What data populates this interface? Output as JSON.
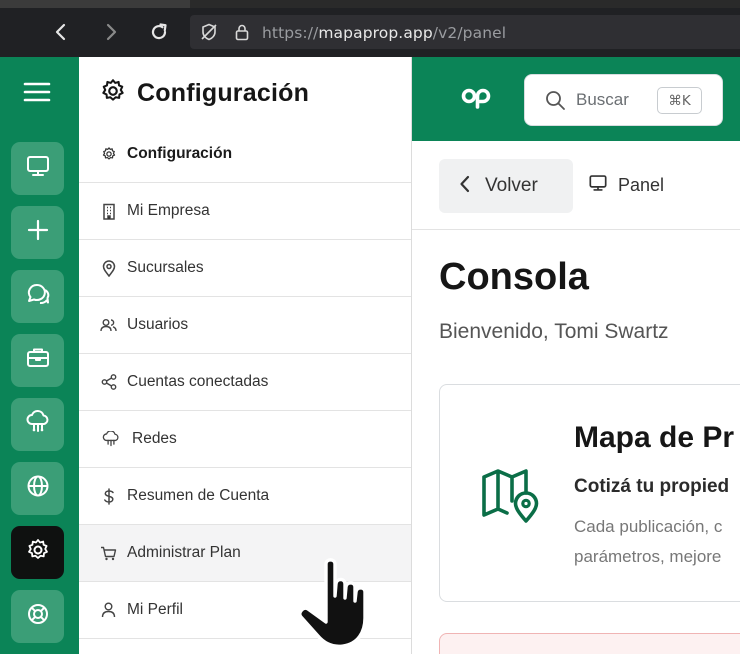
{
  "browser": {
    "url_prefix": "https://",
    "url_host": "mapaprop.app",
    "url_path": "/v2/panel",
    "icons": [
      "back-icon",
      "forward-icon",
      "reload-icon",
      "shield-off-icon",
      "lock-icon"
    ]
  },
  "rail": {
    "items": [
      {
        "name": "menu",
        "icon": "hamburger-icon"
      },
      {
        "name": "panel",
        "icon": "monitor-icon"
      },
      {
        "name": "nuevo",
        "icon": "plus-icon"
      },
      {
        "name": "mensajes",
        "icon": "chat-icon"
      },
      {
        "name": "negocios",
        "icon": "briefcase-icon"
      },
      {
        "name": "redes",
        "icon": "cloud-network-icon"
      },
      {
        "name": "web",
        "icon": "globe-icon"
      },
      {
        "name": "configuracion",
        "icon": "gear-icon",
        "active": true
      },
      {
        "name": "soporte",
        "icon": "lifebuoy-icon"
      }
    ],
    "color": "#0b8457",
    "button_color": "#3b9e77",
    "active_color": "#0f1110"
  },
  "settings": {
    "title": "Configuración",
    "items": [
      {
        "label": "Configuración",
        "icon": "gear-icon",
        "bold": true
      },
      {
        "label": "Mi Empresa",
        "icon": "building-icon"
      },
      {
        "label": "Sucursales",
        "icon": "map-pin-icon"
      },
      {
        "label": "Usuarios",
        "icon": "users-icon"
      },
      {
        "label": "Cuentas conectadas",
        "icon": "share-icon"
      },
      {
        "label": "Redes",
        "icon": "cloud-network-icon"
      },
      {
        "label": "Resumen de Cuenta",
        "icon": "dollar-icon"
      },
      {
        "label": "Administrar Plan",
        "icon": "cart-icon",
        "hovered": true
      },
      {
        "label": "Mi Perfil",
        "icon": "user-icon"
      }
    ]
  },
  "header": {
    "logo": "op",
    "search_placeholder": "Buscar",
    "search_shortcut": "⌘K"
  },
  "subnav": {
    "back_label": "Volver",
    "panel_label": "Panel"
  },
  "main": {
    "title": "Consola",
    "welcome": "Bienvenido, Tomi Swartz",
    "card": {
      "title": "Mapa de Pr",
      "subtitle": "Cotizá tu propied",
      "text_line1": "Cada publicación, c",
      "text_line2": "parámetros, mejore",
      "icon": "map-pin-map-icon"
    }
  },
  "colors": {
    "brand": "#0b8457",
    "alert_border": "#f0b4b4"
  }
}
